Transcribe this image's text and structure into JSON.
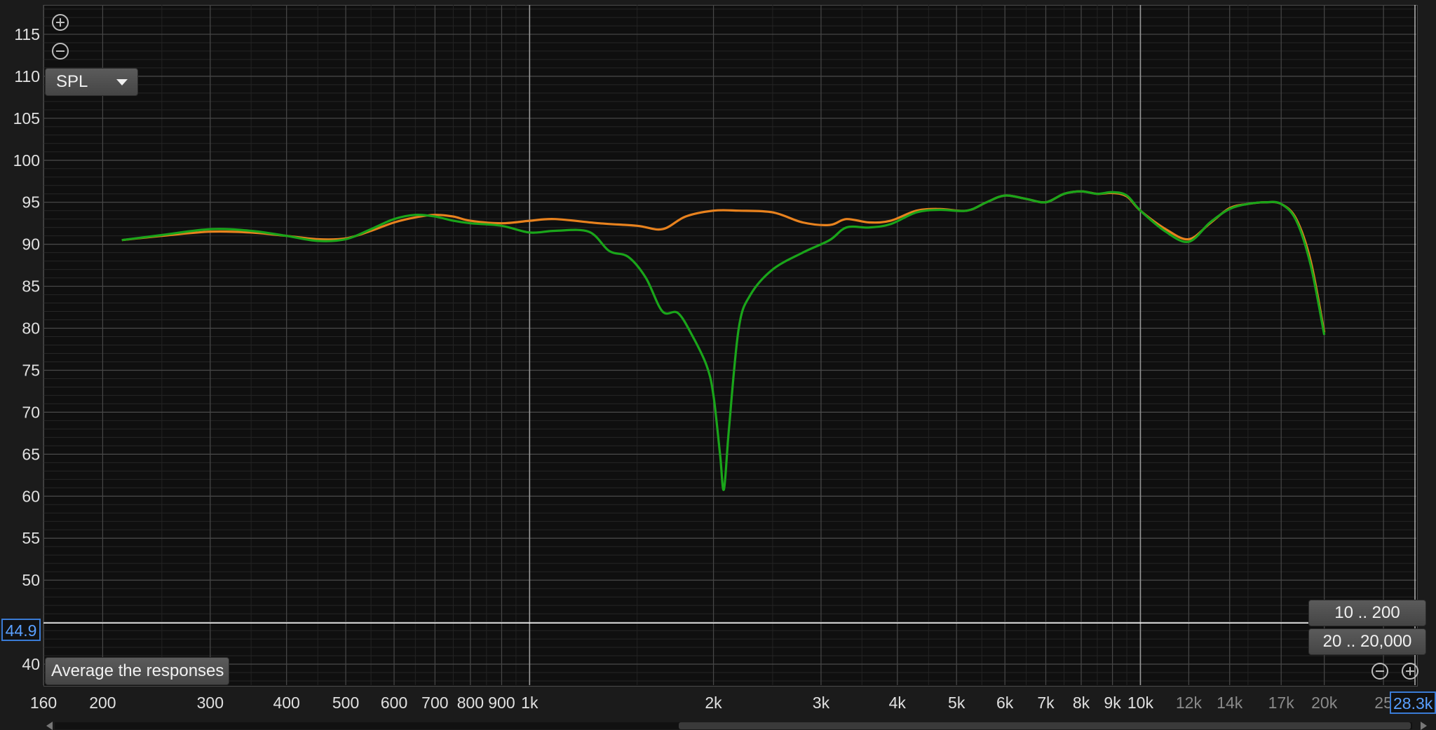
{
  "controls": {
    "measurement_dropdown": "SPL",
    "average_button": "Average the responses",
    "range_preset_a": "10 .. 200",
    "range_preset_b": "20 .. 20,000"
  },
  "readouts": {
    "y_cursor": "44.9",
    "x_max": "28.3k"
  },
  "icons": {
    "top_zoom_in": "zoom-in-icon",
    "top_zoom_out": "zoom-out-icon",
    "bottom_zoom_out": "zoom-out-icon",
    "bottom_zoom_in": "zoom-in-icon"
  },
  "colors": {
    "background": "#0f0f0f",
    "orange": "#e8821e",
    "green": "#1aa51a",
    "cursor": "#ffffff",
    "readout": "#3a7bd5"
  },
  "chart_data": {
    "type": "line",
    "title": "",
    "xlabel": "",
    "ylabel": "",
    "x_scale": "log",
    "xlim": [
      160,
      28300
    ],
    "ylim": [
      37.5,
      118.5
    ],
    "grid": true,
    "y_ticks": [
      40,
      45,
      50,
      55,
      60,
      65,
      70,
      75,
      80,
      85,
      90,
      95,
      100,
      105,
      110,
      115
    ],
    "y_tick_labels": [
      "40",
      "",
      "50",
      "55",
      "60",
      "65",
      "70",
      "75",
      "80",
      "85",
      "90",
      "95",
      "100",
      "105",
      "110",
      "115"
    ],
    "x_ticks": [
      160,
      200,
      300,
      400,
      500,
      600,
      700,
      800,
      900,
      1000,
      2000,
      3000,
      4000,
      5000,
      6000,
      7000,
      8000,
      9000,
      10000,
      12000,
      14000,
      17000,
      20000,
      25000
    ],
    "x_tick_labels": [
      "160",
      "200",
      "300",
      "400",
      "500",
      "600",
      "700",
      "800",
      "900",
      "1k",
      "2k",
      "3k",
      "4k",
      "5k",
      "6k",
      "7k",
      "8k",
      "9k",
      "10k",
      "12k",
      "14k",
      "17k",
      "20k",
      "25"
    ],
    "cursor": {
      "y": 44.9,
      "x": 10000
    },
    "series": [
      {
        "color": "#e8821e",
        "x": [
          215,
          250,
          300,
          350,
          400,
          450,
          500,
          550,
          600,
          650,
          700,
          750,
          800,
          900,
          1000,
          1100,
          1300,
          1500,
          1650,
          1800,
          2000,
          2200,
          2500,
          2800,
          3100,
          3300,
          3600,
          3900,
          4300,
          4700,
          5200,
          5600,
          6000,
          6500,
          7000,
          7500,
          8000,
          8500,
          9000,
          9500,
          10000,
          11000,
          12000,
          13000,
          14000,
          15000,
          16000,
          17000,
          18000,
          19000,
          20000
        ],
        "y": [
          90.5,
          91.0,
          91.5,
          91.4,
          91.0,
          90.6,
          90.7,
          91.6,
          92.6,
          93.2,
          93.5,
          93.3,
          92.8,
          92.5,
          92.8,
          93.0,
          92.5,
          92.2,
          91.8,
          93.3,
          94.0,
          94.0,
          93.8,
          92.6,
          92.3,
          93.0,
          92.6,
          92.8,
          94.0,
          94.2,
          94.0,
          95.0,
          95.8,
          95.4,
          95.0,
          96.0,
          96.3,
          96.0,
          96.1,
          95.7,
          94.0,
          91.8,
          90.6,
          92.5,
          94.3,
          94.8,
          95.0,
          94.8,
          93.0,
          88.0,
          79.5
        ]
      },
      {
        "color": "#1aa51a",
        "x": [
          215,
          250,
          300,
          350,
          400,
          450,
          500,
          550,
          600,
          650,
          700,
          750,
          800,
          900,
          1000,
          1100,
          1250,
          1350,
          1450,
          1550,
          1650,
          1750,
          1850,
          1950,
          2000,
          2050,
          2080,
          2120,
          2200,
          2300,
          2500,
          2800,
          3100,
          3300,
          3600,
          3900,
          4300,
          4700,
          5200,
          5600,
          6000,
          6500,
          7000,
          7500,
          8000,
          8500,
          9000,
          9500,
          10000,
          11000,
          12000,
          13000,
          14000,
          15000,
          16000,
          17000,
          18000,
          19000,
          20000
        ],
        "y": [
          90.5,
          91.1,
          91.8,
          91.6,
          91.0,
          90.4,
          90.6,
          91.8,
          93.0,
          93.5,
          93.3,
          92.8,
          92.5,
          92.2,
          91.4,
          91.6,
          91.5,
          89.2,
          88.5,
          86.0,
          82.0,
          81.8,
          79.0,
          75.5,
          72.0,
          65.0,
          60.8,
          68.0,
          80.0,
          84.0,
          87.0,
          89.0,
          90.5,
          92.0,
          92.0,
          92.4,
          93.8,
          94.1,
          94.0,
          95.0,
          95.8,
          95.4,
          95.0,
          96.0,
          96.3,
          96.0,
          96.2,
          95.8,
          94.0,
          91.5,
          90.3,
          92.6,
          94.2,
          94.8,
          95.0,
          94.8,
          92.8,
          87.5,
          79.2
        ]
      }
    ]
  }
}
